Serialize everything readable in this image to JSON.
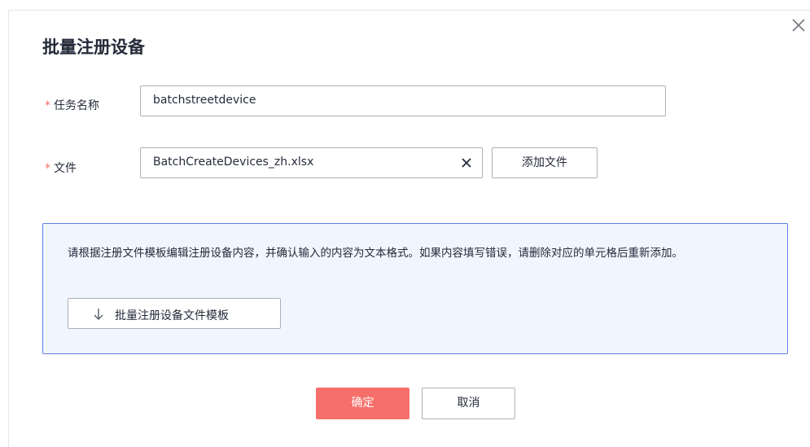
{
  "dialog": {
    "title": "批量注册设备",
    "required_mark": "*",
    "task_name_label": "任务名称",
    "task_name_value": "batchstreetdevice",
    "file_label": "文件",
    "file_value": "BatchCreateDevices_zh.xlsx",
    "add_file_label": "添加文件",
    "info_text": "请根据注册文件模板编辑注册设备内容，并确认输入的内容为文本格式。如果内容填写错误，请删除对应的单元格后重新添加。",
    "download_template_label": "批量注册设备文件模板",
    "ok_label": "确定",
    "cancel_label": "取消"
  },
  "colors": {
    "primary": "#f66f6a",
    "info_bg": "#f0f6fd",
    "info_border": "#5e7ce0"
  }
}
